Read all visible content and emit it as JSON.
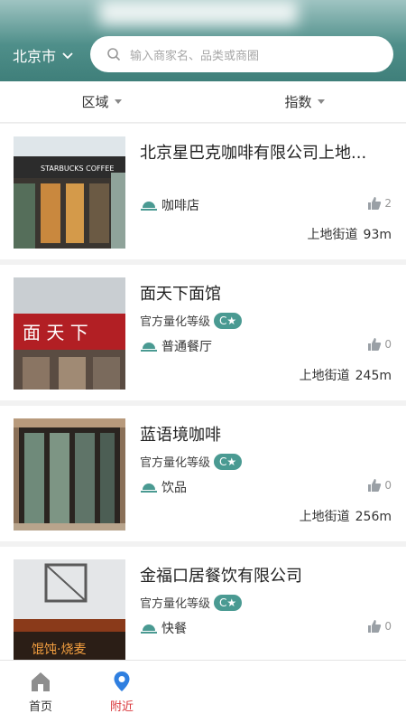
{
  "header": {
    "city": "北京市",
    "search_placeholder": "输入商家名、品类或商圈"
  },
  "filters": {
    "area_label": "区域",
    "index_label": "指数"
  },
  "colors": {
    "header": "#4f8f8a",
    "accent": "#4a9a92",
    "active_nav": "#d9373b"
  },
  "merchants": [
    {
      "name": "北京星巴克咖啡有限公司上地...",
      "grade_label": "",
      "grade_badge": "",
      "category": "咖啡店",
      "likes": "2",
      "area": "上地街道",
      "distance": "93m",
      "photo": "starbucks-storefront"
    },
    {
      "name": "面天下面馆",
      "grade_label": "官方量化等级",
      "grade_badge": "C★",
      "category": "普通餐厅",
      "likes": "0",
      "area": "上地街道",
      "distance": "245m",
      "photo": "noodle-shop-sign"
    },
    {
      "name": "蓝语境咖啡",
      "grade_label": "官方量化等级",
      "grade_badge": "C★",
      "category": "饮品",
      "likes": "0",
      "area": "上地街道",
      "distance": "256m",
      "photo": "cafe-glass-doors"
    },
    {
      "name": "金福口居餐饮有限公司",
      "grade_label": "官方量化等级",
      "grade_badge": "C★",
      "category": "快餐",
      "likes": "0",
      "area": "",
      "distance": "",
      "photo": "restaurant-interior"
    }
  ],
  "photo_signs": {
    "starbucks": "STARBUCKS COFFEE",
    "noodle": "面 天 下",
    "restaurant": "馄饨·烧麦"
  },
  "bottom_nav": {
    "home_label": "首页",
    "nearby_label": "附近"
  }
}
